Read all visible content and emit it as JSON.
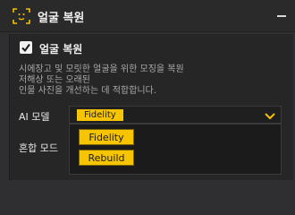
{
  "header": {
    "title": "얼굴 복원",
    "icon": "face-scan-icon",
    "collapse_icon": "minus-icon"
  },
  "panel": {
    "checkbox": {
      "label": "얼굴 복원",
      "checked": true
    },
    "description": [
      "시에장고 및 모릿한 얼굴을 위한 모징을 복원",
      "저해상 또는 오래된",
      "인물 사진을 개선하는 데 적합합니다."
    ],
    "ai_model": {
      "label": "AI 모델",
      "selected": "Fidelity",
      "options": [
        "Fidelity",
        "Rebuild"
      ]
    },
    "blend_mode": {
      "label": "혼합 모드"
    }
  },
  "colors": {
    "accent": "#f7c400",
    "background": "#2f2f31",
    "panel": "#262627"
  }
}
